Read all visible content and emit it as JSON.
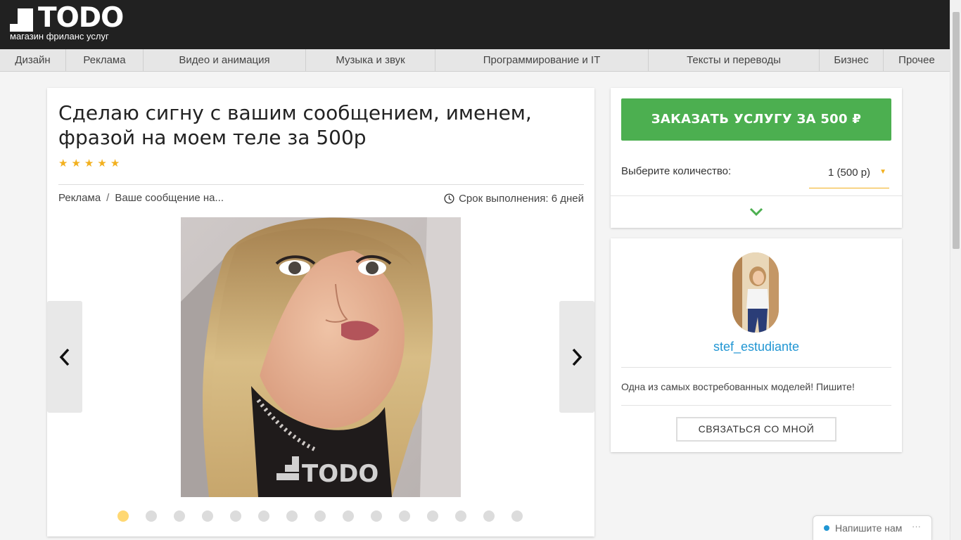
{
  "header": {
    "logo_title": "TODO",
    "logo_subtitle": "магазин фриланс услуг"
  },
  "nav": {
    "items": [
      {
        "label": "Дизайн"
      },
      {
        "label": "Реклама"
      },
      {
        "label": "Видео и анимация"
      },
      {
        "label": "Музыка и звук"
      },
      {
        "label": "Программирование и IT"
      },
      {
        "label": "Тексты и переводы"
      },
      {
        "label": "Бизнес"
      },
      {
        "label": "Прочее"
      }
    ]
  },
  "gig": {
    "title": "Сделаю сигну с вашим сообщением, именем, фразой на моем теле за 500р",
    "rating_stars": 5,
    "breadcrumb": [
      "Реклама",
      "Ваше сообщение на..."
    ],
    "breadcrumb_separator": "/",
    "deadline": "Срок выполнения: 6 дней",
    "image_watermark": "TODO",
    "gallery": {
      "count": 15,
      "active_index": 0
    }
  },
  "order": {
    "button_label": "ЗАКАЗАТЬ УСЛУГУ ЗА 500 ₽",
    "quantity_label": "Выберите количество:",
    "quantity_value": "1 (500 р)",
    "accent_color": "#4caf50"
  },
  "seller": {
    "name": "stef_estudiante",
    "bio": "Одна из самых востребованных моделей! Пишите!",
    "contact_label": "СВЯЗАТЬСЯ СО МНОЙ"
  },
  "chat": {
    "label": "Напишите нам",
    "more": "···"
  },
  "colors": {
    "header_bg": "#212121",
    "link": "#2196d3",
    "star": "#f2b01e",
    "dot_active": "#ffd873"
  },
  "icons": [
    "logo-mark-icon",
    "star-icon",
    "clock-icon",
    "chevron-left-icon",
    "chevron-right-icon",
    "chevron-down-icon",
    "caret-down-icon",
    "online-dot-icon"
  ]
}
